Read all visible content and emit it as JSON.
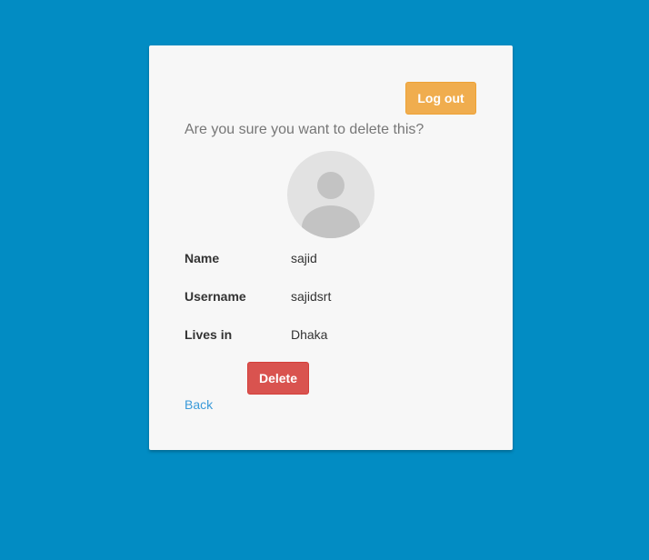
{
  "header": {
    "logout_label": "Log out"
  },
  "confirm": {
    "question": "Are you sure you want to delete this?",
    "avatar_icon": "user-placeholder-icon"
  },
  "details": [
    {
      "label": "Name",
      "value": "sajid"
    },
    {
      "label": "Username",
      "value": "sajidsrt"
    },
    {
      "label": "Lives in",
      "value": "Dhaka"
    }
  ],
  "actions": {
    "delete_label": "Delete",
    "back_label": "Back"
  },
  "colors": {
    "background": "#028cc3",
    "card": "#f7f7f7",
    "warning": "#f0ad4e",
    "danger": "#d9534f",
    "link": "#3a9ad9"
  }
}
